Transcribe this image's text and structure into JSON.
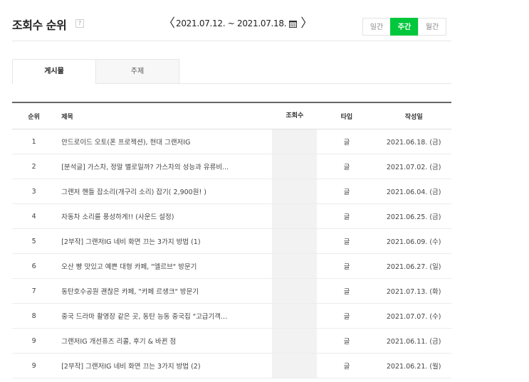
{
  "header": {
    "title": "조회수 순위",
    "help_icon": "question-icon",
    "date_range": "2021.07.12. ~ 2021.07.18.",
    "prev_arrow": "〈",
    "next_arrow": "〉",
    "calendar_icon": "calendar-icon",
    "period_buttons": [
      {
        "label": "일간",
        "active": false
      },
      {
        "label": "주간",
        "active": true
      },
      {
        "label": "월간",
        "active": false
      }
    ],
    "accent_color": "#00c73c"
  },
  "tabs": [
    {
      "label": "게시물",
      "active": true
    },
    {
      "label": "주제",
      "active": false
    }
  ],
  "table": {
    "columns": [
      "순위",
      "제목",
      "조회수",
      "타입",
      "작성일"
    ],
    "rows": [
      {
        "rank": "1",
        "title": "안드로이드 오토(폰 프로젝션), 현대 그랜저IG",
        "views": "",
        "type": "글",
        "date": "2021.06.18. (금)"
      },
      {
        "rank": "2",
        "title": "[분석글] 가스차, 정말 별로일까? 가스차의 성능과 유류비...",
        "views": "",
        "type": "글",
        "date": "2021.07.02. (금)"
      },
      {
        "rank": "3",
        "title": "그랜저 핸들 잡소리(개구리 소리) 잡기( 2,900원! )",
        "views": "",
        "type": "글",
        "date": "2021.06.04. (금)"
      },
      {
        "rank": "4",
        "title": "자동차 소리를 풍성하게!! (사운드 설정)",
        "views": "",
        "type": "글",
        "date": "2021.06.25. (금)"
      },
      {
        "rank": "5",
        "title": "[2부작] 그랜저IG 네비 화면 끄는 3가지 방법 (1)",
        "views": "",
        "type": "글",
        "date": "2021.06.09. (수)"
      },
      {
        "rank": "6",
        "title": "오산 빵 맛있고 예쁜 대형 카페, \"엘르브\" 방문기",
        "views": "",
        "type": "글",
        "date": "2021.06.27. (일)"
      },
      {
        "rank": "7",
        "title": "동탄호수공원 괜찮은 카페, \"카페 르생크\" 방문기",
        "views": "",
        "type": "글",
        "date": "2021.07.13. (화)"
      },
      {
        "rank": "8",
        "title": "중국 드라마 촬영장 같은 곳, 동탄 능동 중국집 \"고급기객...",
        "views": "",
        "type": "글",
        "date": "2021.07.07. (수)"
      },
      {
        "rank": "9",
        "title": "그랜저IG 개선퓨즈 리콜, 후기 & 바뀐 점",
        "views": "",
        "type": "글",
        "date": "2021.06.11. (금)"
      },
      {
        "rank": "9",
        "title": "[2부작] 그랜저IG 네비 화면 끄는 3가지 방법 (2)",
        "views": "",
        "type": "글",
        "date": "2021.06.21. (월)"
      }
    ]
  }
}
